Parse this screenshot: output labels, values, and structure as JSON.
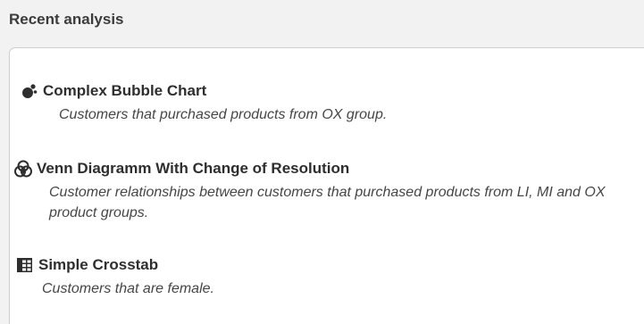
{
  "panel": {
    "title": "Recent analysis"
  },
  "items": [
    {
      "icon": "bubble-chart-icon",
      "title": "Complex Bubble Chart",
      "description": "Customers that purchased products from OX group."
    },
    {
      "icon": "venn-diagram-icon",
      "title": "Venn Diagramm With Change of Resolution",
      "description": "Customer relationships between customers that purchased products from  LI, MI and OX product groups."
    },
    {
      "icon": "crosstab-icon",
      "title": "Simple Crosstab",
      "description": "Customers that are female."
    }
  ]
}
